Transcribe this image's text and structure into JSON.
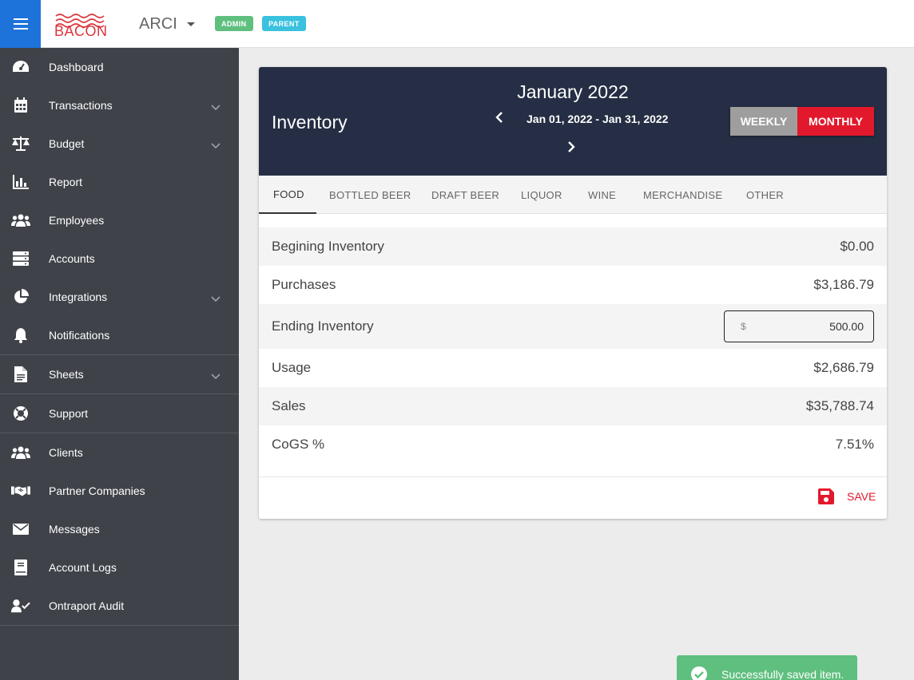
{
  "header": {
    "logo_text": "BACON",
    "org_name": "ARCI",
    "badges": [
      "ADMIN",
      "PARENT"
    ]
  },
  "sidebar": {
    "items": [
      {
        "label": "Dashboard",
        "icon": "dashboard-gauge-icon",
        "expandable": false
      },
      {
        "label": "Transactions",
        "icon": "calendar-icon",
        "expandable": true
      },
      {
        "label": "Budget",
        "icon": "scale-icon",
        "expandable": true
      },
      {
        "label": "Report",
        "icon": "bar-chart-icon",
        "expandable": false
      },
      {
        "label": "Employees",
        "icon": "users-icon",
        "expandable": false
      },
      {
        "label": "Accounts",
        "icon": "server-icon",
        "expandable": false
      },
      {
        "label": "Integrations",
        "icon": "pie-chart-icon",
        "expandable": true
      },
      {
        "label": "Notifications",
        "icon": "bell-icon",
        "expandable": false
      },
      {
        "label": "Sheets",
        "icon": "file-icon",
        "expandable": true
      },
      {
        "label": "Support",
        "icon": "life-ring-icon",
        "expandable": false
      },
      {
        "label": "Clients",
        "icon": "users-icon",
        "expandable": false
      },
      {
        "label": "Partner Companies",
        "icon": "handshake-icon",
        "expandable": false
      },
      {
        "label": "Messages",
        "icon": "envelope-icon",
        "expandable": false
      },
      {
        "label": "Account Logs",
        "icon": "book-icon",
        "expandable": false
      },
      {
        "label": "Ontraport Audit",
        "icon": "user-check-icon",
        "expandable": false
      }
    ]
  },
  "card": {
    "title": "Inventory",
    "month": "January 2022",
    "range": "Jan 01, 2022 - Jan 31, 2022",
    "toggle": {
      "weekly": "WEEKLY",
      "monthly": "MONTHLY",
      "selected": "MONTHLY"
    },
    "tabs": [
      "FOOD",
      "BOTTLED BEER",
      "DRAFT BEER",
      "LIQUOR",
      "WINE",
      "MERCHANDISE",
      "OTHER"
    ],
    "active_tab": "FOOD",
    "rows": {
      "beginning": {
        "label": "Begining Inventory",
        "value": "$0.00"
      },
      "purchases": {
        "label": "Purchases",
        "value": "$3,186.79"
      },
      "ending": {
        "label": "Ending Inventory",
        "currency": "$",
        "value": "500.00"
      },
      "usage": {
        "label": "Usage",
        "value": "$2,686.79"
      },
      "sales": {
        "label": "Sales",
        "value": "$35,788.74"
      },
      "cogs": {
        "label": "CoGS %",
        "value": "7.51%"
      }
    },
    "save_label": "SAVE"
  },
  "toast": {
    "message": "Successfully saved item."
  },
  "colors": {
    "primary_blue": "#1d73d9",
    "sidebar_bg": "#3f4349",
    "header_dark": "#252e44",
    "accent_red": "#e2192c",
    "success_green": "#5fbf7f",
    "badge_cyan": "#39c1df"
  }
}
